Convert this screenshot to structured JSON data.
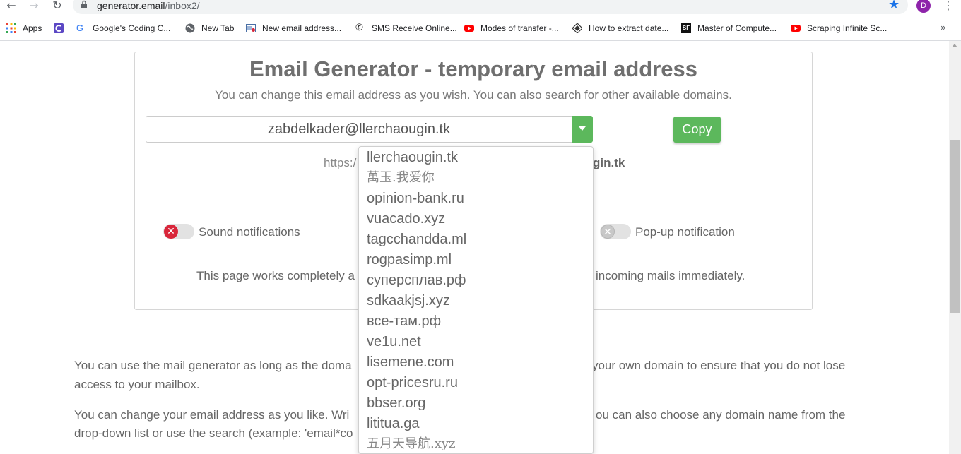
{
  "browser": {
    "url_host": "generator.email",
    "url_path": "/inbox2/",
    "profile_initial": "D",
    "bookmarks": [
      {
        "label": "Apps",
        "icon": "apps-grid-icon"
      },
      {
        "label": "",
        "icon": "coursera-icon"
      },
      {
        "label": "Google's Coding C...",
        "icon": "google-icon"
      },
      {
        "label": "New Tab",
        "icon": "globe-icon"
      },
      {
        "label": "New email address...",
        "icon": "mail-page-icon"
      },
      {
        "label": "SMS Receive Online...",
        "icon": "phone-icon"
      },
      {
        "label": "Modes of transfer -...",
        "icon": "youtube-icon"
      },
      {
        "label": "How to extract date...",
        "icon": "diamond-icon"
      },
      {
        "label": "Master of Compute...",
        "icon": "sf-icon"
      },
      {
        "label": "Scraping Infinite Sc...",
        "icon": "youtube-icon"
      }
    ],
    "more_label": "»"
  },
  "colors": {
    "accent_green": "#5cb85c",
    "sound_toggle_red": "#d9263a",
    "text_grey": "#666666"
  },
  "main": {
    "title": "Email Generator - temporary email address",
    "subtitle": "You can change this email address as you wish. You can also search for other available domains.",
    "email_value": "zabdelkader@llerchaougin.tk",
    "copy_label": "Copy",
    "link_prefix": "https:/",
    "link_suffix": "gin.tk",
    "sound_label": "Sound notifications",
    "popup_label": "Pop-up notification",
    "works_left": "This page works completely a",
    "works_right": "incoming mails immediately."
  },
  "info": {
    "p1_line1_left": "You can use the mail generator as long as the doma",
    "p1_line1_right": "your own domain to ensure that you do not lose",
    "p1_line2": "access to your mailbox.",
    "p2_line1_left": "You can change your email address as you like. Wri",
    "p2_line1_right": "ou can also choose any domain name from the",
    "p2_line2": "drop-down list or use the search (example: 'email*co"
  },
  "domains": [
    "llerchaougin.tk",
    "萬玉.我爱你",
    "opinion-bank.ru",
    "vuacado.xyz",
    "tagcchandda.ml",
    "rogpasimp.ml",
    "суперсплав.рф",
    "sdkaakjsj.xyz",
    "все-там.рф",
    "ve1u.net",
    "lisemene.com",
    "opt-pricesru.ru",
    "bbser.org",
    "lititua.ga",
    "五月天导航.xyz"
  ]
}
